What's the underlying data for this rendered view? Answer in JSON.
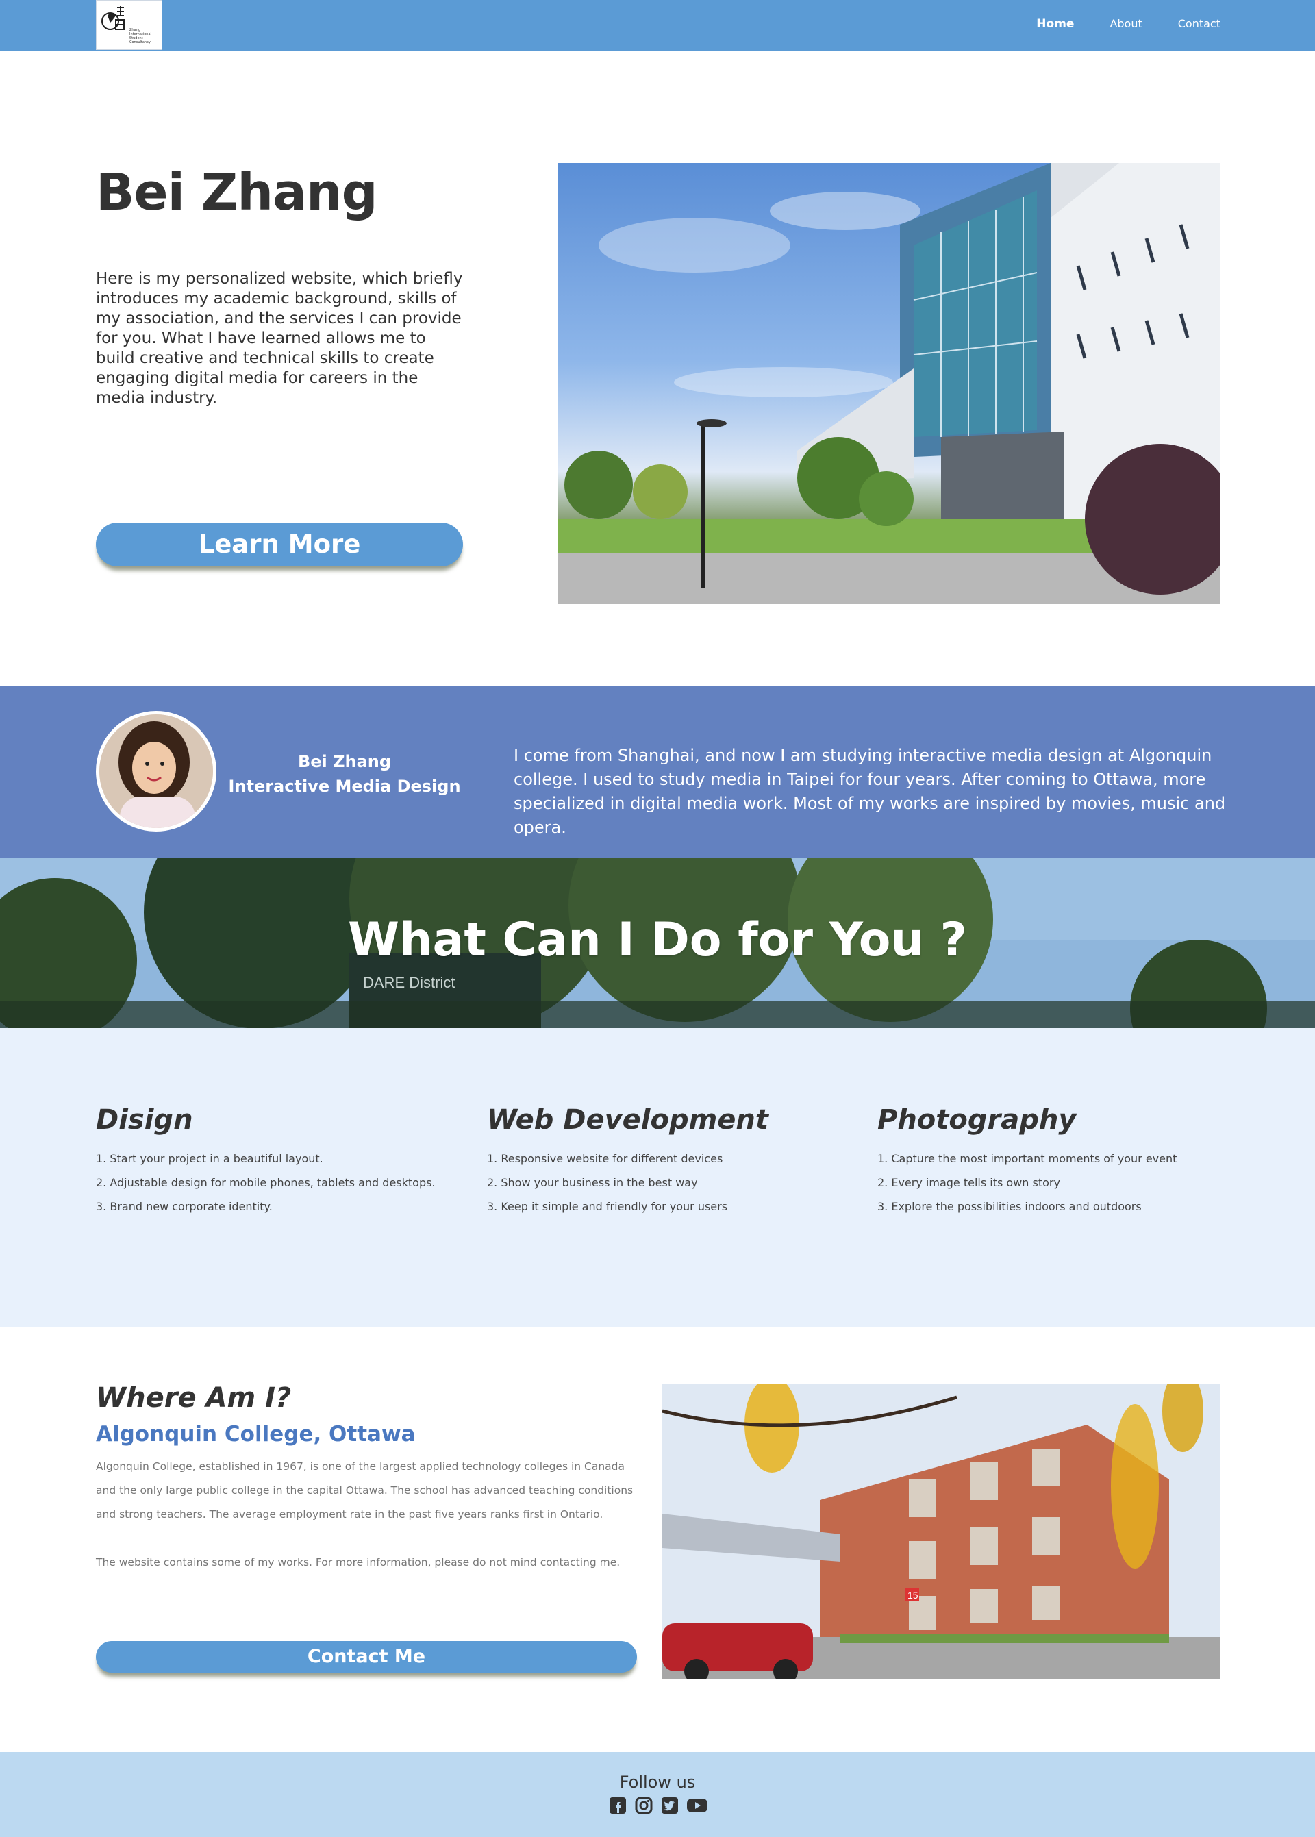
{
  "nav": {
    "logo_alt": "Zhang International Student Consultancy",
    "logo_text": "Zhang\nInternational\nStudent\nConsultancy",
    "links": [
      {
        "label": "Home",
        "active": true
      },
      {
        "label": "About",
        "active": false
      },
      {
        "label": "Contact",
        "active": false
      }
    ]
  },
  "hero": {
    "title": "Bei Zhang",
    "text": "Here is my personalized website, which briefly introduces my academic background, skills of my association, and the services I can provide for you. What I have learned allows me to build creative and technical skills to create engaging digital media for careers in the media industry.",
    "button": "Learn More",
    "photo": "college-building-photo"
  },
  "profile": {
    "name": "Bei Zhang",
    "program": "Interactive Media Design",
    "bio": "I come from Shanghai, and now I am studying interactive media design at Algonquin college. I used to study media in Taipei for four years. After coming to Ottawa, more specialized in digital media work. Most of my works are inspired by movies, music and opera."
  },
  "banner": {
    "title": "What Can I Do for You ?",
    "sign": "DARE District"
  },
  "services": [
    {
      "title": "Disign",
      "items": [
        "1. Start your project in a beautiful layout.",
        "2. Adjustable design for mobile phones, tablets and desktops.",
        "3. Brand new corporate identity."
      ]
    },
    {
      "title": "Web Development",
      "items": [
        "1. Responsive website for different devices",
        "2. Show your business in the best way",
        "3. Keep it simple and friendly for your users"
      ]
    },
    {
      "title": "Photography",
      "items": [
        "1. Capture the most important moments of your event",
        "2. Every image tells its own story",
        "3. Explore the possibilities indoors and outdoors"
      ]
    }
  ],
  "where": {
    "title": "Where Am I?",
    "subtitle": "Algonquin College, Ottawa",
    "paragraph1": "Algonquin College, established in 1967, is one of the largest applied technology colleges in Canada and the only large public college in the capital Ottawa. The school has advanced teaching conditions and strong teachers. The average employment rate in the past five years ranks first in Ontario.",
    "paragraph2": "The website contains some of my works. For more information, please do not mind contacting me.",
    "button": "Contact  Me",
    "photo_number": "15"
  },
  "footer": {
    "follow": "Follow us",
    "social": [
      "facebook-icon",
      "instagram-icon",
      "twitter-icon",
      "youtube-icon"
    ]
  },
  "colors": {
    "nav": "#5b9bd5",
    "profile_band": "#6381c0",
    "services_bg": "#e8f1fc",
    "footer_bg": "#bcd9f1",
    "accent": "#4a78c0"
  }
}
